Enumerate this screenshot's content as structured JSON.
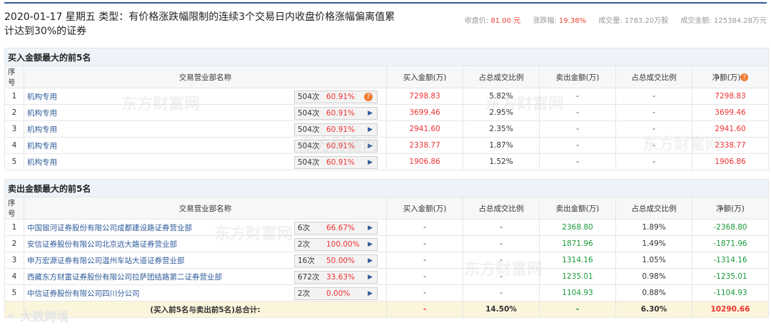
{
  "header": {
    "title": "2020-01-17 星期五  类型：有价格涨跌幅限制的连续3个交易日内收盘价格涨幅偏离值累计达到30%的证券",
    "close_label": "收盘价:",
    "close_value": "81.00 元",
    "change_label": "涨跌幅:",
    "change_value": "19.38%",
    "volume_label": "成交量:",
    "volume_value": "1783.20万股",
    "amount_label": "成交金额:",
    "amount_value": "125384.28万元"
  },
  "buy": {
    "title": "买入金额最大的前5名",
    "columns": [
      "序号",
      "交易营业部名称",
      "买入金额(万)",
      "占总成交比例",
      "卖出金额(万)",
      "占总成交比例",
      "净额(万)"
    ],
    "rows": [
      {
        "no": "1",
        "name": "机构专用",
        "count": "504次",
        "pct": "60.91%",
        "buy": "7298.83",
        "buy_ratio": "5.82%",
        "sell": "-",
        "sell_ratio": "-",
        "net": "7298.83"
      },
      {
        "no": "2",
        "name": "机构专用",
        "count": "504次",
        "pct": "60.91%",
        "buy": "3699.46",
        "buy_ratio": "2.95%",
        "sell": "-",
        "sell_ratio": "-",
        "net": "3699.46"
      },
      {
        "no": "3",
        "name": "机构专用",
        "count": "504次",
        "pct": "60.91%",
        "buy": "2941.60",
        "buy_ratio": "2.35%",
        "sell": "-",
        "sell_ratio": "-",
        "net": "2941.60"
      },
      {
        "no": "4",
        "name": "机构专用",
        "count": "504次",
        "pct": "60.91%",
        "buy": "2338.77",
        "buy_ratio": "1.87%",
        "sell": "-",
        "sell_ratio": "-",
        "net": "2338.77"
      },
      {
        "no": "5",
        "name": "机构专用",
        "count": "504次",
        "pct": "60.91%",
        "buy": "1906.86",
        "buy_ratio": "1.52%",
        "sell": "-",
        "sell_ratio": "-",
        "net": "1906.86"
      }
    ]
  },
  "sell": {
    "title": "卖出金额最大的前5名",
    "columns": [
      "序号",
      "交易营业部名称",
      "买入金额(万)",
      "占总成交比例",
      "卖出金额(万)",
      "占总成交比例",
      "净额(万)"
    ],
    "rows": [
      {
        "no": "1",
        "name": "中国银河证券股份有限公司成都建设路证券营业部",
        "count": "6次",
        "pct": "66.67%",
        "buy": "-",
        "buy_ratio": "-",
        "sell": "2368.80",
        "sell_ratio": "1.89%",
        "net": "-2368.80"
      },
      {
        "no": "2",
        "name": "安信证券股份有限公司北京远大路证券营业部",
        "count": "2次",
        "pct": "100.00%",
        "buy": "-",
        "buy_ratio": "-",
        "sell": "1871.96",
        "sell_ratio": "1.49%",
        "net": "-1871.96"
      },
      {
        "no": "3",
        "name": "申万宏源证券有限公司温州车站大道证券营业部",
        "count": "16次",
        "pct": "50.00%",
        "buy": "-",
        "buy_ratio": "-",
        "sell": "1314.16",
        "sell_ratio": "1.05%",
        "net": "-1314.16"
      },
      {
        "no": "4",
        "name": "西藏东方财富证券股份有限公司拉萨团结路第二证券营业部",
        "count": "672次",
        "pct": "33.63%",
        "buy": "-",
        "buy_ratio": "-",
        "sell": "1235.01",
        "sell_ratio": "0.98%",
        "net": "-1235.01"
      },
      {
        "no": "5",
        "name": "中信证券股份有限公司四川分公司",
        "count": "2次",
        "pct": "0.00%",
        "buy": "-",
        "buy_ratio": "-",
        "sell": "1104.93",
        "sell_ratio": "0.88%",
        "net": "-1104.93"
      }
    ],
    "total": {
      "label": "(买入前5名与卖出前5名)总合计:",
      "buy": "-",
      "buy_ratio": "14.50%",
      "sell": "-",
      "sell_ratio": "6.30%",
      "net": "10290.66"
    }
  },
  "watermark": "东方财富网",
  "logo_text": "大数跨境",
  "icons": {
    "question": "question-icon",
    "arrow": "triangle-right-icon"
  }
}
